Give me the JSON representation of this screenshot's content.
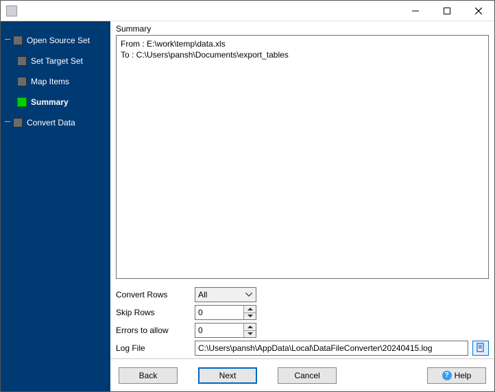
{
  "titlebar": {
    "title": ""
  },
  "wizard": {
    "steps": [
      {
        "label": "Open Source Set",
        "active": false,
        "child": false
      },
      {
        "label": "Set Target Set",
        "active": false,
        "child": true
      },
      {
        "label": "Map Items",
        "active": false,
        "child": true
      },
      {
        "label": "Summary",
        "active": true,
        "child": true
      },
      {
        "label": "Convert Data",
        "active": false,
        "child": false
      }
    ]
  },
  "panel": {
    "header": "Summary",
    "lines": [
      "From : E:\\work\\temp\\data.xls",
      "To : C:\\Users\\pansh\\Documents\\export_tables"
    ]
  },
  "form": {
    "convert_rows_label": "Convert Rows",
    "convert_rows_value": "All",
    "convert_rows_options": [
      "All"
    ],
    "skip_rows_label": "Skip Rows",
    "skip_rows_value": "0",
    "errors_allow_label": "Errors to allow",
    "errors_allow_value": "0",
    "log_file_label": "Log File",
    "log_file_value": "C:\\Users\\pansh\\AppData\\Local\\DataFileConverter\\20240415.log"
  },
  "buttons": {
    "back": "Back",
    "next": "Next",
    "cancel": "Cancel",
    "help": "Help"
  }
}
